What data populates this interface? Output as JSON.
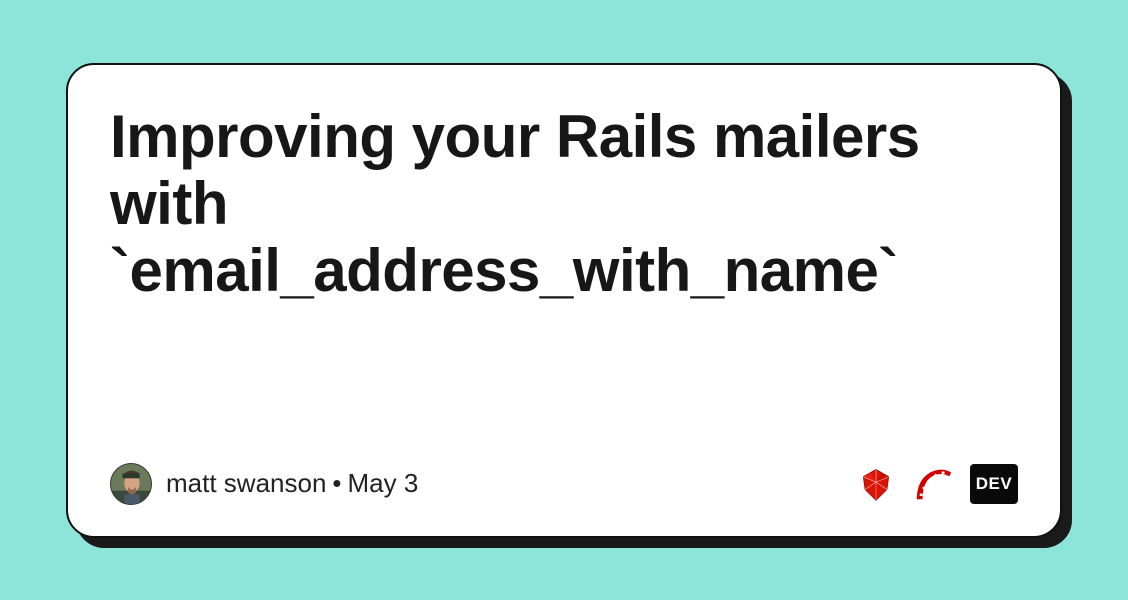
{
  "card": {
    "title": "Improving your Rails mailers with `email_address_with_name`"
  },
  "byline": {
    "author": "matt swanson",
    "date": "May 3"
  },
  "badges": {
    "dev": "DEV"
  }
}
